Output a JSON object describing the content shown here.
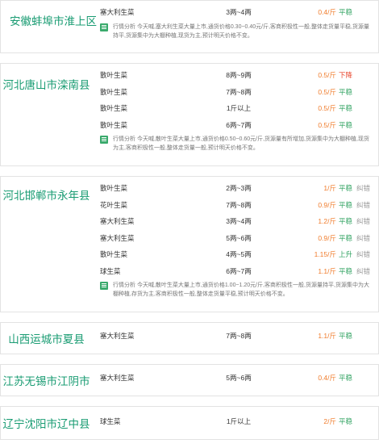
{
  "markets": [
    {
      "region": "安徽蚌埠市淮上区",
      "rows": [
        {
          "product": "塞大利生菜",
          "spec": "3两~4两",
          "price": "0.4/斤",
          "trend": "平稳",
          "more": ""
        }
      ],
      "analysis": "行情分析 今天喊,塞大利生菜大量上市,通货价格0.30~0.40元/斤,客商积极性一般,整体走货量平稳,货源量持平,货源集中为大棚种植,现货为主,预计明天价格不变。"
    },
    {
      "region": "河北唐山市滦南县",
      "rows": [
        {
          "product": "散叶生菜",
          "spec": "8两~9两",
          "price": "0.5/斤",
          "trend": "下降",
          "more": ""
        },
        {
          "product": "散叶生菜",
          "spec": "7两~8两",
          "price": "0.5/斤",
          "trend": "平稳",
          "more": ""
        },
        {
          "product": "散叶生菜",
          "spec": "1斤以上",
          "price": "0.5/斤",
          "trend": "平稳",
          "more": ""
        },
        {
          "product": "散叶生菜",
          "spec": "6两~7两",
          "price": "0.5/斤",
          "trend": "平稳",
          "more": ""
        }
      ],
      "analysis": "行情分析 今天喊,散叶生菜大量上市,通货价格0.50~0.60元/斤,货源量有所增加,货源集中为大棚种植,现货为主,客商积极性一般,整体走货量一般,预计明天价格不变。"
    },
    {
      "region": "河北邯郸市永年县",
      "rows": [
        {
          "product": "散叶生菜",
          "spec": "2两~3两",
          "price": "1/斤",
          "trend": "平稳",
          "more": "纠错"
        },
        {
          "product": "花叶生菜",
          "spec": "7两~8两",
          "price": "0.9/斤",
          "trend": "平稳",
          "more": "纠错"
        },
        {
          "product": "塞大利生菜",
          "spec": "3两~4两",
          "price": "1.2/斤",
          "trend": "平稳",
          "more": "纠错"
        },
        {
          "product": "塞大利生菜",
          "spec": "5两~6两",
          "price": "0.9/斤",
          "trend": "平稳",
          "more": "纠错"
        },
        {
          "product": "散叶生菜",
          "spec": "4两~5两",
          "price": "1.15/斤",
          "trend": "上升",
          "more": "纠错"
        },
        {
          "product": "球生菜",
          "spec": "6两~7两",
          "price": "1.1/斤",
          "trend": "平稳",
          "more": "纠错"
        }
      ],
      "analysis": "行情分析 今天喊,散叶生菜大量上市,通货价格1.00~1.20元/斤,客商积极性一般,货源量持平,货源集中为大棚种植,存货为主,客商积极性一般,整体走货量平稳,预计明天价格不变。"
    },
    {
      "region": "山西运城市夏县",
      "rows": [
        {
          "product": "塞大利生菜",
          "spec": "7两~8两",
          "price": "1.1/斤",
          "trend": "平稳",
          "more": ""
        }
      ],
      "analysis": ""
    },
    {
      "region": "江苏无锡市江阴市",
      "rows": [
        {
          "product": "塞大利生菜",
          "spec": "5两~6两",
          "price": "0.4/斤",
          "trend": "平稳",
          "more": ""
        }
      ],
      "analysis": ""
    },
    {
      "region": "辽宁沈阳市辽中县",
      "rows": [
        {
          "product": "球生菜",
          "spec": "1斤以上",
          "price": "2/斤",
          "trend": "平稳",
          "more": ""
        }
      ],
      "analysis": ""
    }
  ]
}
